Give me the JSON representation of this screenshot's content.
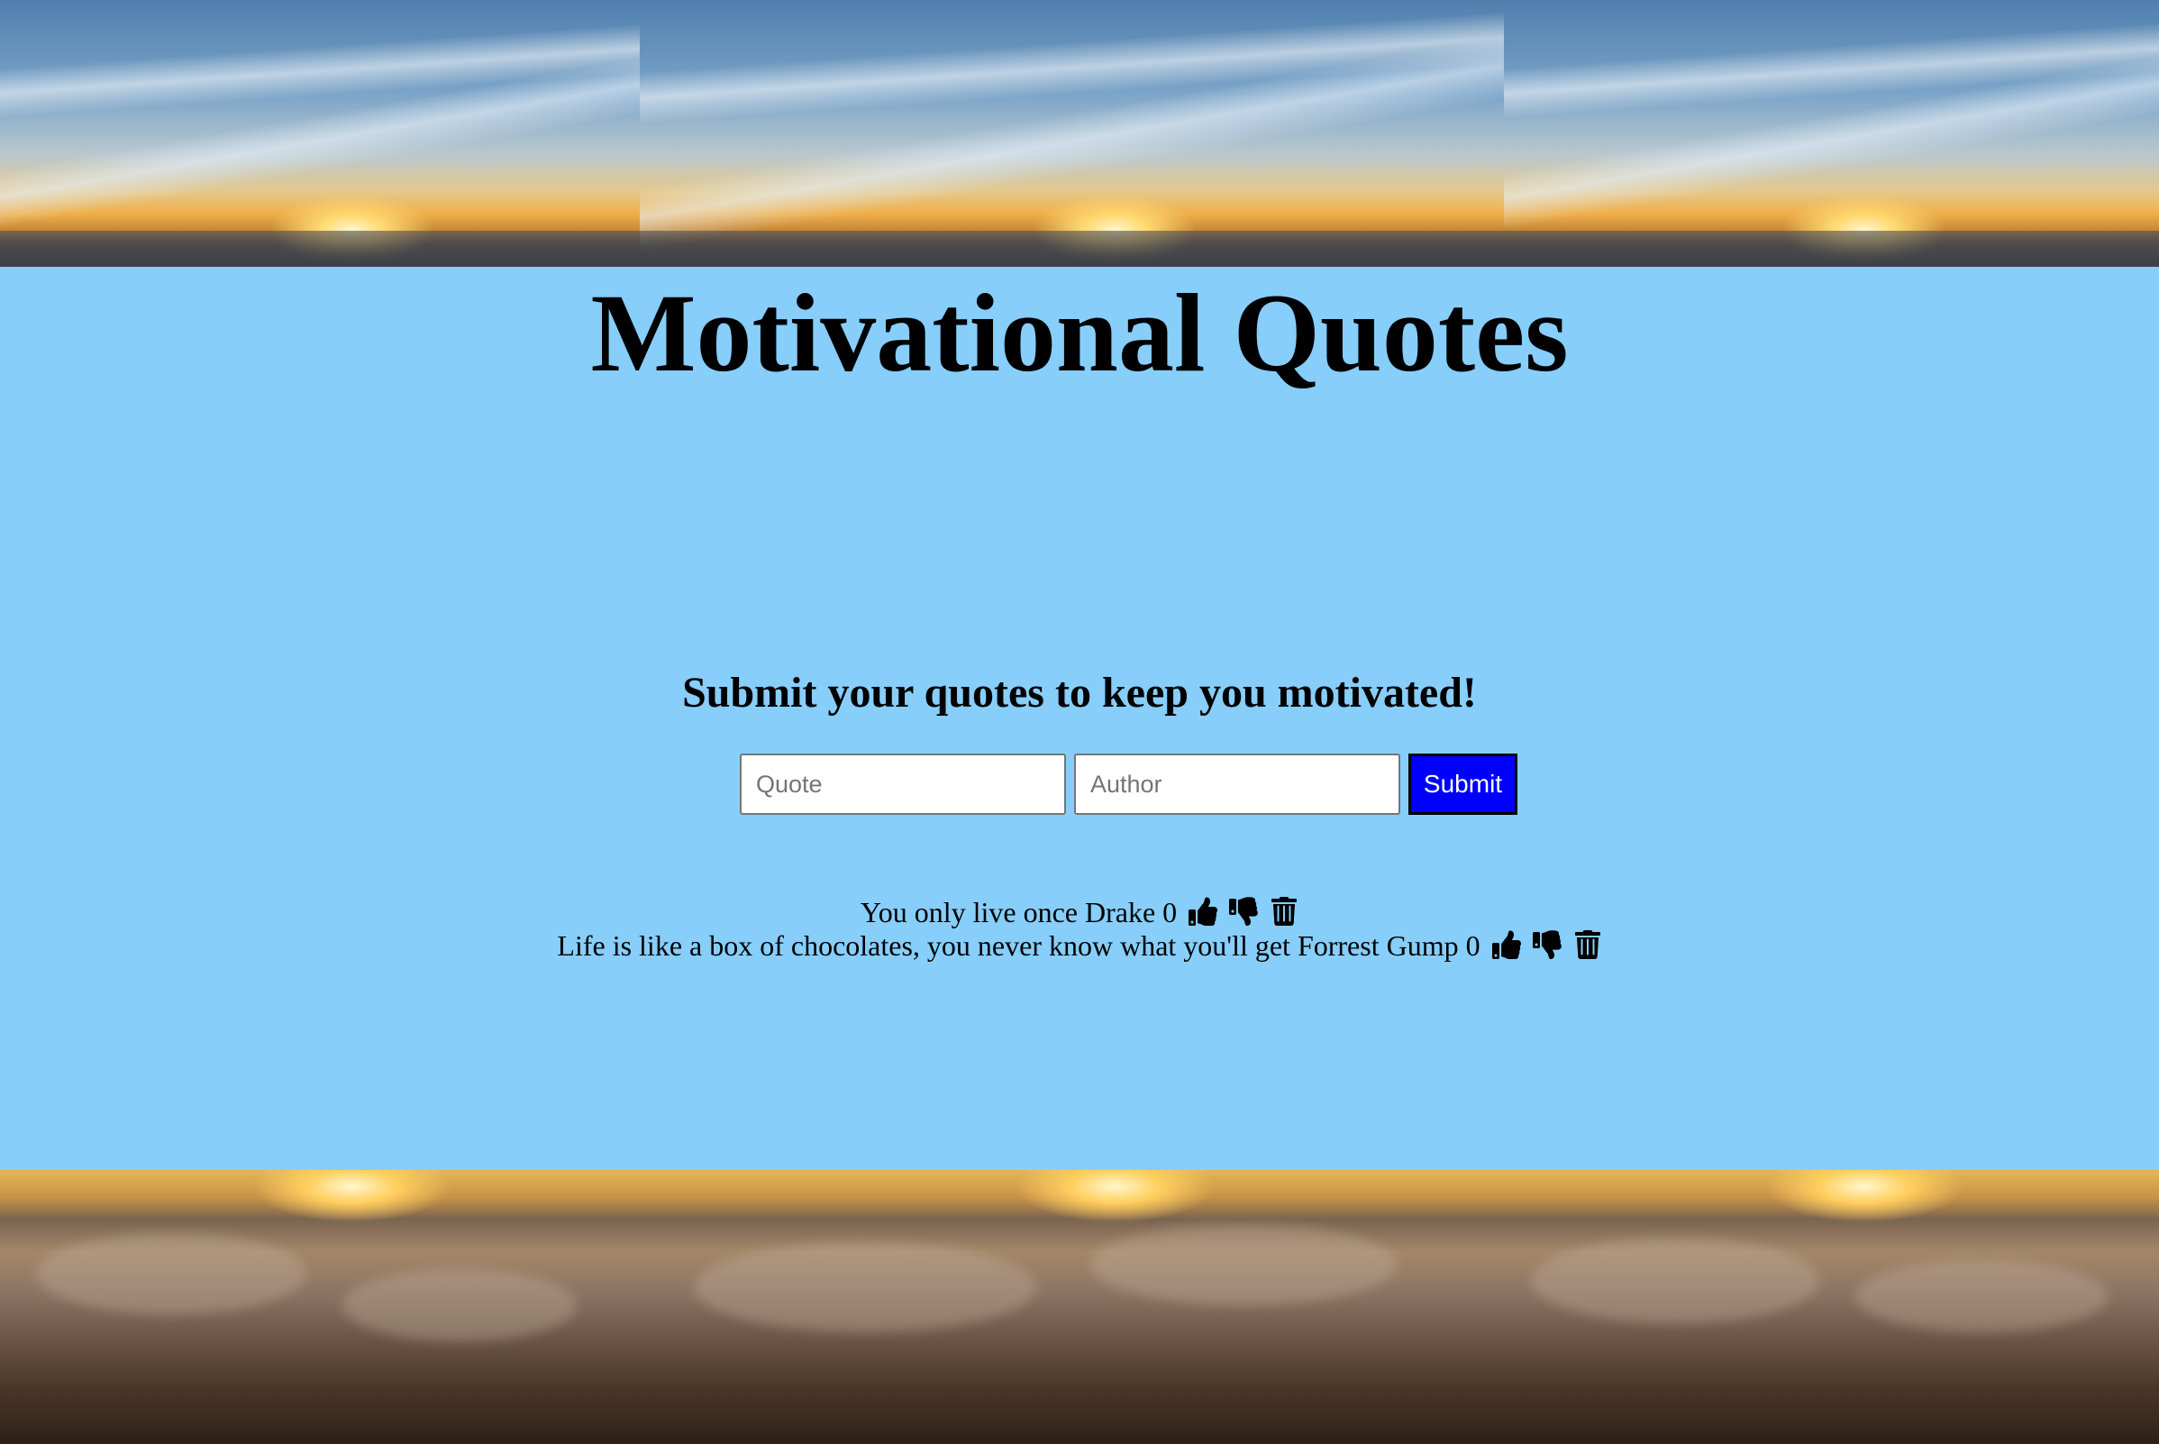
{
  "header": {
    "title": "Motivational Quotes",
    "subtitle": "Submit your quotes to keep you motivated!"
  },
  "form": {
    "quote_placeholder": "Quote",
    "author_placeholder": "Author",
    "submit_label": "Submit"
  },
  "quotes": [
    {
      "text": "You only live once",
      "author": "Drake",
      "votes": "0"
    },
    {
      "text": "Life is like a box of chocolates, you never know what you'll get",
      "author": "Forrest Gump",
      "votes": "0"
    }
  ],
  "icons": {
    "like": "thumbs-up-icon",
    "dislike": "thumbs-down-icon",
    "delete": "trash-icon"
  },
  "colors": {
    "background": "#87cefa",
    "submit_button": "#0000ff"
  }
}
